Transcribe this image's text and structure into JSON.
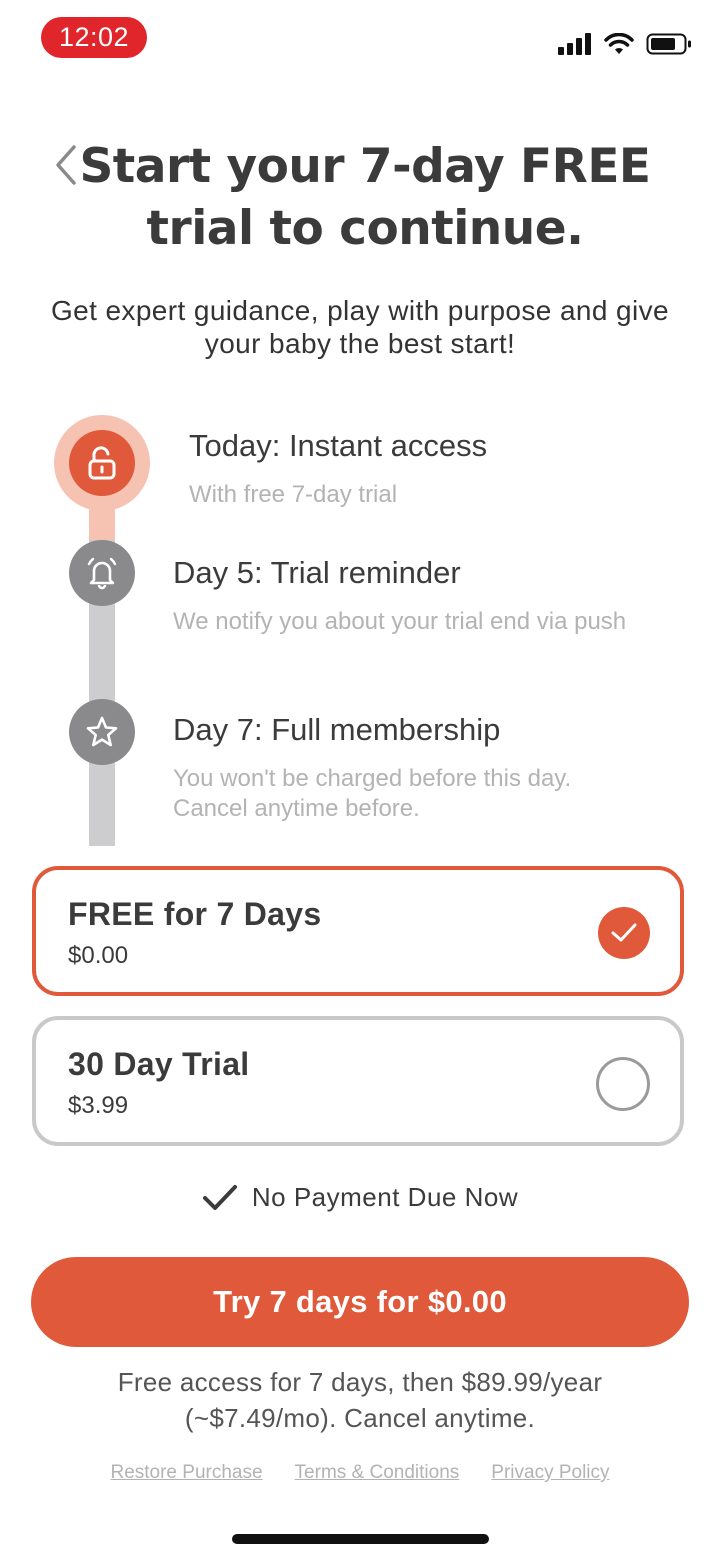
{
  "status_bar": {
    "time": "12:02"
  },
  "header": {
    "title": "Start your 7-day FREE trial to continue.",
    "subtitle": "Get expert guidance, play with purpose and give your baby the best start!"
  },
  "timeline": [
    {
      "title": "Today: Instant access",
      "description": "With free 7-day trial",
      "icon": "unlock-icon"
    },
    {
      "title": "Day 5: Trial reminder",
      "description": "We notify you about your trial end via push",
      "icon": "bell-icon"
    },
    {
      "title": "Day 7: Full membership",
      "description": "You won't be charged before this day. Cancel anytime before.",
      "icon": "star-icon"
    }
  ],
  "options": [
    {
      "title": "FREE for 7 Days",
      "price": "$0.00",
      "selected": true
    },
    {
      "title": "30 Day Trial",
      "price": "$3.99",
      "selected": false
    }
  ],
  "no_payment_note": "No Payment Due Now",
  "cta_label": "Try 7 days for $0.00",
  "fine_print": "Free access for 7 days, then $89.99/year (~$7.49/mo). Cancel anytime.",
  "footer_links": [
    "Restore Purchase",
    "Terms & Conditions",
    "Privacy Policy"
  ],
  "colors": {
    "accent": "#e0593a",
    "accent_light": "#f6c3b3",
    "status_pill": "#e0262b",
    "muted": "#8a8a8d"
  }
}
